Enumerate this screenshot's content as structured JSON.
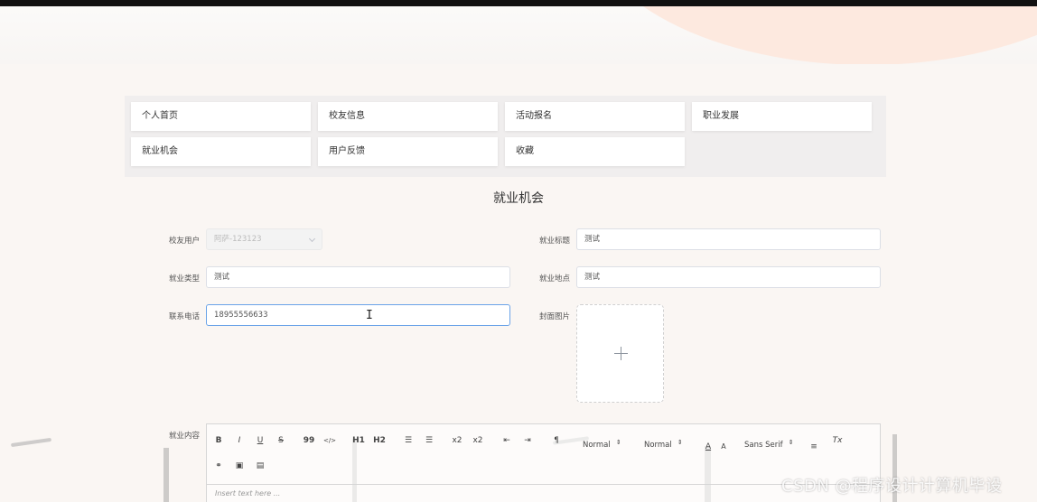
{
  "nav": {
    "items": [
      {
        "label": "个人首页"
      },
      {
        "label": "校友信息"
      },
      {
        "label": "活动报名"
      },
      {
        "label": "职业发展"
      },
      {
        "label": "就业机会"
      },
      {
        "label": "用户反馈"
      },
      {
        "label": "收藏"
      }
    ]
  },
  "page": {
    "title": "就业机会"
  },
  "form": {
    "alumni_user": {
      "label": "校友用户",
      "value": "阿萨-123123"
    },
    "job_title": {
      "label": "就业标题",
      "value": "测试"
    },
    "job_type": {
      "label": "就业类型",
      "value": "测试"
    },
    "job_location": {
      "label": "就业地点",
      "value": "测试"
    },
    "contact_phone": {
      "label": "联系电话",
      "value": "18955556633"
    },
    "cover_image": {
      "label": "封面图片",
      "upload_icon": "plus-icon"
    },
    "content": {
      "label": "就业内容",
      "placeholder": "Insert text here ...",
      "toolbar": {
        "bold": "B",
        "italic": "I",
        "underline": "U",
        "strike": "S",
        "blockquote": "99",
        "code": "</>",
        "h1": "H1",
        "h2": "H2",
        "subscript": "x2",
        "superscript": "x2",
        "size_select": "Normal",
        "header_select": "Normal",
        "font_select": "Sans Serif",
        "clean": "Tx"
      }
    }
  },
  "watermark": "CSDN @程序设计计算机毕设",
  "colors": {
    "accent_focus": "#6aa3e8",
    "hero_blob": "#fde9df",
    "background": "#faf6f3"
  }
}
